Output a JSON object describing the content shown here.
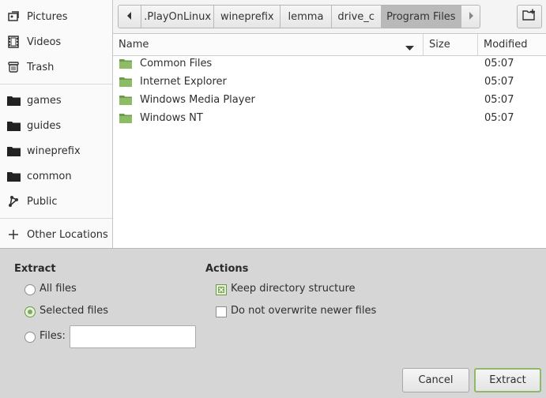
{
  "sidebar": {
    "items": [
      {
        "label": "Pictures",
        "icon": "pictures-icon"
      },
      {
        "label": "Videos",
        "icon": "videos-icon"
      },
      {
        "label": "Trash",
        "icon": "trash-icon"
      },
      {
        "label": "games",
        "icon": "folder-icon"
      },
      {
        "label": "guides",
        "icon": "folder-icon"
      },
      {
        "label": "wineprefix",
        "icon": "folder-icon"
      },
      {
        "label": "common",
        "icon": "folder-icon"
      },
      {
        "label": "Public",
        "icon": "share-icon"
      },
      {
        "label": "Other Locations",
        "icon": "plus-icon"
      }
    ]
  },
  "pathbar": {
    "crumbs": [
      ".PlayOnLinux",
      "wineprefix",
      "lemma",
      "drive_c",
      "Program Files"
    ],
    "active": "Program Files"
  },
  "filelist": {
    "columns": {
      "name": "Name",
      "size": "Size",
      "modified": "Modified"
    },
    "rows": [
      {
        "name": "Common Files",
        "size": "",
        "modified": "05:07"
      },
      {
        "name": "Internet Explorer",
        "size": "",
        "modified": "05:07"
      },
      {
        "name": "Windows Media Player",
        "size": "",
        "modified": "05:07"
      },
      {
        "name": "Windows NT",
        "size": "",
        "modified": "05:07"
      }
    ]
  },
  "extract": {
    "title": "Extract",
    "all_files": "All files",
    "selected_files": "Selected files",
    "files_label": "Files:",
    "files_value": "",
    "selected": "selected_files"
  },
  "actions": {
    "title": "Actions",
    "keep_structure": "Keep directory structure",
    "keep_structure_checked": true,
    "no_overwrite": "Do not overwrite newer files",
    "no_overwrite_checked": false
  },
  "buttons": {
    "cancel": "Cancel",
    "extract": "Extract"
  },
  "colors": {
    "accent": "#7fac5c",
    "folder": "#6d9b4a"
  }
}
